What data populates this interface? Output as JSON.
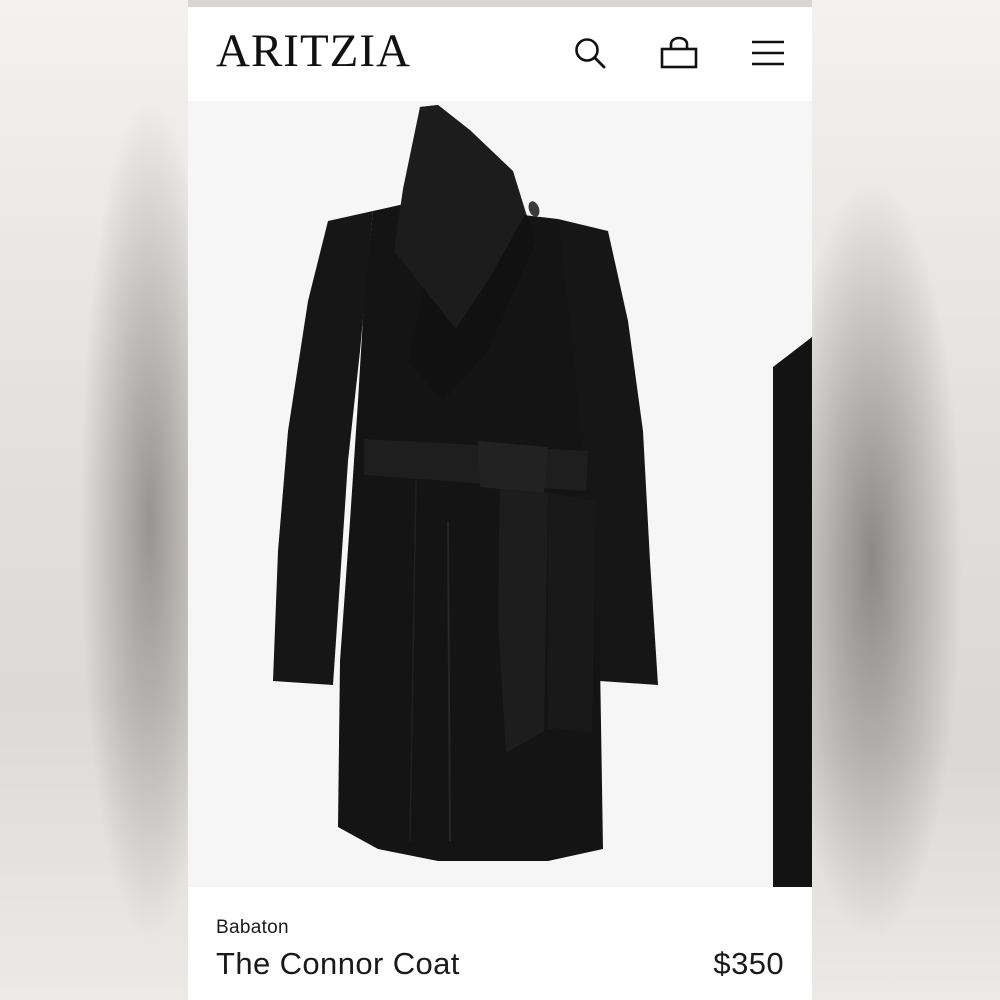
{
  "header": {
    "logo": "ARITZIA",
    "icons": {
      "search": "search-icon",
      "bag": "shopping-bag-icon",
      "menu": "hamburger-menu-icon"
    }
  },
  "product": {
    "brand": "Babaton",
    "name": "The Connor Coat",
    "price": "$350",
    "image": "black-wrap-coat-with-belt"
  },
  "colors": {
    "page_background": "#ffffff",
    "gallery_background": "#f6f6f7",
    "text": "#1a1a1a",
    "coat": "#141414"
  }
}
